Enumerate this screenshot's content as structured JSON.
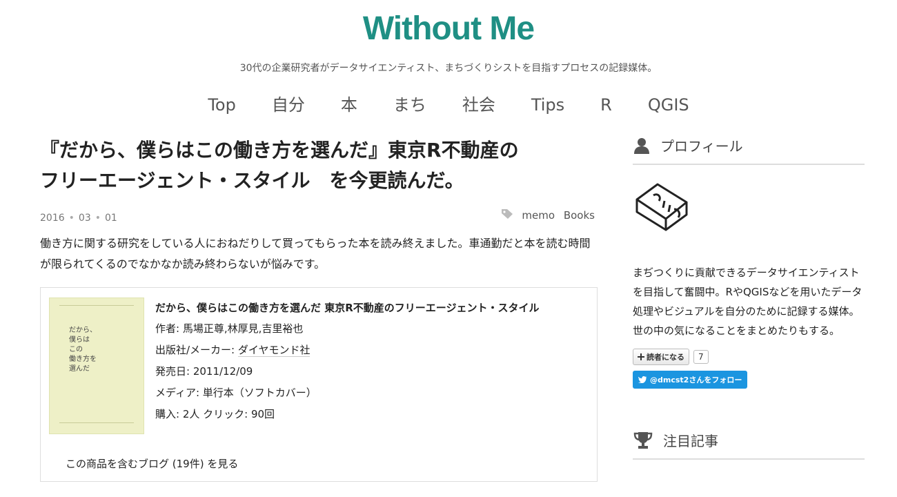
{
  "header": {
    "site_title": "Without Me",
    "tagline": "30代の企業研究者がデータサイエンティスト、まちづくりシストを目指すプロセスの記録媒体。"
  },
  "nav": {
    "items": [
      {
        "label": "Top"
      },
      {
        "label": "自分"
      },
      {
        "label": "本"
      },
      {
        "label": "まち"
      },
      {
        "label": "社会"
      },
      {
        "label": "Tips"
      },
      {
        "label": "R"
      },
      {
        "label": "QGIS"
      }
    ]
  },
  "entry": {
    "title_line1": "『だから、僕らはこの働き方を選んだ』東京R不動産の",
    "title_line2": "フリーエージェント・スタイル　を今更読んだ。",
    "date": {
      "year": "2016",
      "month": "03",
      "day": "01"
    },
    "categories": [
      "memo",
      "Books"
    ],
    "intro": "働き方に関する研究をしている人におねだりして買ってもらった本を読み終えました。車通勤だと本を読む時間が限られてくるのでなかなか読み終わらないが悩みです。"
  },
  "book": {
    "cover_text": [
      "だから、",
      "僕らは",
      "この",
      "働き方を",
      "選んだ"
    ],
    "title": "だから、僕らはこの働き方を選んだ 東京R不動産のフリーエージェント・スタイル",
    "author_label": "作者: ",
    "author": "馬場正尊,林厚見,吉里裕也",
    "publisher_label": "出版社/メーカー: ",
    "publisher": "ダイヤモンド社",
    "release_label": "発売日: ",
    "release": "2011/12/09",
    "media_label": "メディア: ",
    "media": "単行本（ソフトカバー）",
    "purchase": "購入: 2人 クリック: 90回",
    "blog_link": "この商品を含むブログ (19件) を見る"
  },
  "sidebar": {
    "profile_heading": "プロフィール",
    "profile_text_1": "まぢつくりに貢献できるデータサイエンティストを目指して奮闘中。RやQGISなどを用いたデータ処理やビジュアルを自分のために記録する媒体。",
    "profile_text_2": "世の中の気になることをまとめたりもする。",
    "reader_button": "読者になる",
    "reader_count": "7",
    "twitter_button": "@dmcst2さんをフォロー",
    "featured_heading": "注目記事",
    "icons": {
      "profile": "user-icon",
      "featured": "trophy-icon",
      "tag": "tag-icon",
      "twitter": "twitter-bird-icon",
      "plus": "plus-icon"
    }
  },
  "colors": {
    "brand": "#1f8f84",
    "twitter": "#1b95e0",
    "cover": "#eef0c7"
  }
}
